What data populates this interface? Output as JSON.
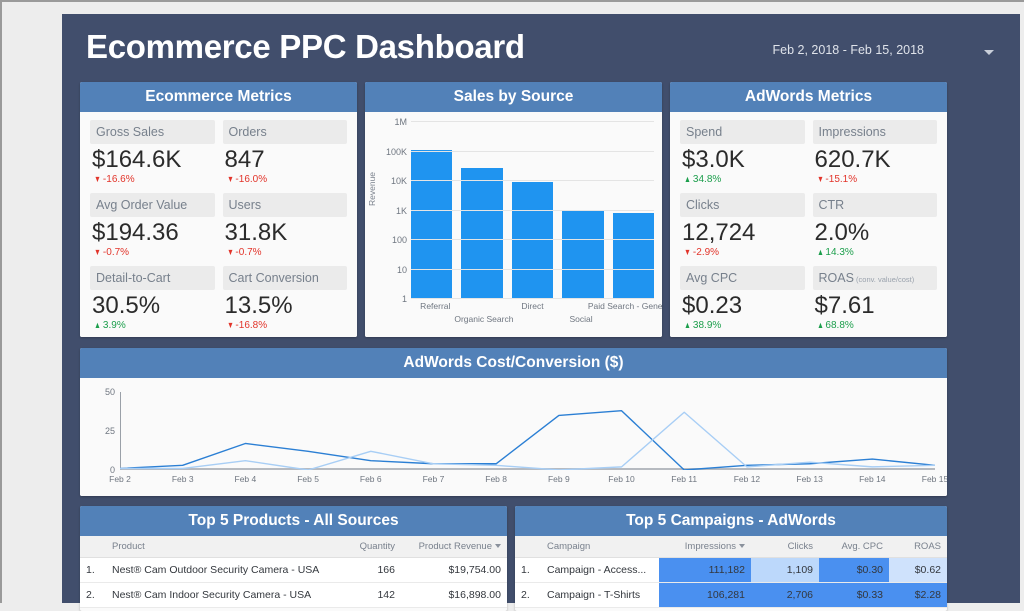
{
  "header": {
    "title": "Ecommerce PPC Dashboard",
    "date_range": "Feb 2, 2018 - Feb 15, 2018",
    "caret_icon": "chevron-down-icon"
  },
  "theme": {
    "page_bg": "#ededed",
    "dash_bg": "#414e6c",
    "panel_head": "#5281b8",
    "bar_blue": "#1f94f0",
    "line_dark": "#2b7fd4",
    "line_light": "#a8cef5",
    "up": "#1b9e4b",
    "down": "#e2342a"
  },
  "ecommerce_metrics": {
    "title": "Ecommerce Metrics",
    "cards": [
      {
        "label": "Gross Sales",
        "sub": "",
        "value": "$164.6K",
        "delta": "-16.6%",
        "dir": "down"
      },
      {
        "label": "Orders",
        "sub": "",
        "value": "847",
        "delta": "-16.0%",
        "dir": "down"
      },
      {
        "label": "Avg Order Value",
        "sub": "",
        "value": "$194.36",
        "delta": "-0.7%",
        "dir": "down"
      },
      {
        "label": "Users",
        "sub": "",
        "value": "31.8K",
        "delta": "-0.7%",
        "dir": "down"
      },
      {
        "label": "Detail-to-Cart",
        "sub": "",
        "value": "30.5%",
        "delta": "3.9%",
        "dir": "up"
      },
      {
        "label": "Cart Conversion",
        "sub": "",
        "value": "13.5%",
        "delta": "-16.8%",
        "dir": "down"
      }
    ]
  },
  "adwords_metrics": {
    "title": "AdWords Metrics",
    "cards": [
      {
        "label": "Spend",
        "sub": "",
        "value": "$3.0K",
        "delta": "34.8%",
        "dir": "up"
      },
      {
        "label": "Impressions",
        "sub": "",
        "value": "620.7K",
        "delta": "-15.1%",
        "dir": "down"
      },
      {
        "label": "Clicks",
        "sub": "",
        "value": "12,724",
        "delta": "-2.9%",
        "dir": "down"
      },
      {
        "label": "CTR",
        "sub": "",
        "value": "2.0%",
        "delta": "14.3%",
        "dir": "up"
      },
      {
        "label": "Avg CPC",
        "sub": "",
        "value": "$0.23",
        "delta": "38.9%",
        "dir": "up"
      },
      {
        "label": "ROAS",
        "sub": "(conv. value/cost)",
        "value": "$7.61",
        "delta": "68.8%",
        "dir": "up"
      }
    ]
  },
  "sales_by_source": {
    "title": "Sales by Source"
  },
  "cost_conversion": {
    "title": "AdWords Cost/Conversion ($)"
  },
  "products_panel": {
    "title": "Top 5 Products - All Sources",
    "columns": [
      "",
      "Product",
      "Quantity",
      "Product Revenue"
    ],
    "sorted_column": "Product Revenue",
    "rows": [
      {
        "idx": "1.",
        "product": "Nest® Cam Outdoor Security Camera - USA",
        "quantity": "166",
        "revenue": "$19,754.00"
      },
      {
        "idx": "2.",
        "product": "Nest® Cam Indoor Security Camera - USA",
        "quantity": "142",
        "revenue": "$16,898.00"
      }
    ]
  },
  "campaigns_panel": {
    "title": "Top 5 Campaigns - AdWords",
    "columns": [
      "",
      "Campaign",
      "Impressions",
      "Clicks",
      "Avg. CPC",
      "ROAS"
    ],
    "sorted_column": "Impressions",
    "rows": [
      {
        "idx": "1.",
        "campaign": "Campaign - Access...",
        "impressions": "111,182",
        "clicks": "1,109",
        "cpc": "$0.30",
        "roas": "$0.62",
        "bg": {
          "impressions": "#4a90f0",
          "clicks": "#bcd8fb",
          "cpc": "#4a90f0",
          "roas": "#cfe2fc"
        }
      },
      {
        "idx": "2.",
        "campaign": "Campaign - T-Shirts",
        "impressions": "106,281",
        "clicks": "2,706",
        "cpc": "$0.33",
        "roas": "$2.28",
        "bg": {
          "impressions": "#4a90f0",
          "clicks": "#4a90f0",
          "cpc": "#4a90f0",
          "roas": "#4a90f0"
        }
      }
    ]
  },
  "chart_data": [
    {
      "type": "bar",
      "title": "Sales by Source",
      "xlabel": "",
      "ylabel": "Revenue",
      "yscale": "log",
      "yticks": [
        "1",
        "10",
        "100",
        "1K",
        "10K",
        "100K",
        "1M"
      ],
      "ylim": [
        1,
        1000000
      ],
      "categories": [
        "Referral",
        "Organic Search",
        "Direct",
        "Social",
        "Paid Search - Generic"
      ],
      "values": [
        115000,
        28000,
        9500,
        1000,
        800
      ],
      "grid": true,
      "legend": "none"
    },
    {
      "type": "line",
      "title": "AdWords Cost/Conversion ($)",
      "xlabel": "",
      "ylabel": "",
      "yticks": [
        0,
        25,
        50
      ],
      "ylim": [
        0,
        50
      ],
      "x": [
        "Feb 2",
        "Feb 3",
        "Feb 4",
        "Feb 5",
        "Feb 6",
        "Feb 7",
        "Feb 8",
        "Feb 9",
        "Feb 10",
        "Feb 11",
        "Feb 12",
        "Feb 13",
        "Feb 14",
        "Feb 15"
      ],
      "series": [
        {
          "name": "series-dark",
          "color": "#2b7fd4",
          "values": [
            1,
            3,
            17,
            12,
            6,
            4,
            4,
            35,
            38,
            0,
            3,
            4,
            7,
            3
          ]
        },
        {
          "name": "series-light",
          "color": "#a8cef5",
          "values": [
            1,
            1,
            6,
            0,
            12,
            4,
            3,
            0,
            2,
            37,
            2,
            5,
            2,
            3
          ]
        }
      ],
      "grid": false,
      "legend": "none"
    }
  ]
}
